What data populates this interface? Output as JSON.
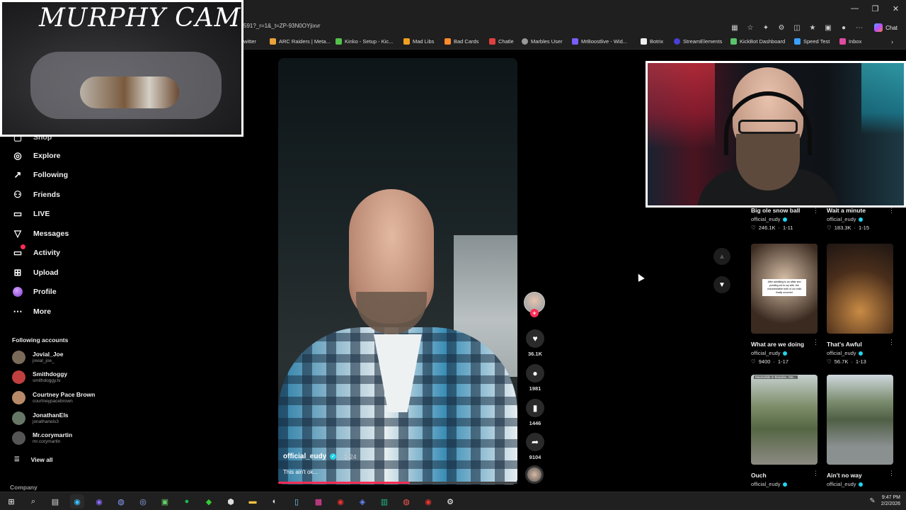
{
  "browser": {
    "url": "591?_r=1&_t=ZP-93N0OYjixvr",
    "chat_label": "Chat",
    "bookmarks": [
      "witter",
      "ARC Raiders | Meta...",
      "Kinko - Setup - Kic...",
      "Mad Libs",
      "Bad Cards",
      "Chatle",
      "Marbles User",
      "MrBoostlive - Wid...",
      "Botrix",
      "StreamElements",
      "KickBot Dashboard",
      "Speed Test",
      "Inbox"
    ]
  },
  "overlay": {
    "cam_title": "MURPHY CAM"
  },
  "sidebar": {
    "partial_item": "Shop",
    "items": [
      {
        "label": "Explore",
        "icon": "compass-icon"
      },
      {
        "label": "Following",
        "icon": "arrow-follow-icon"
      },
      {
        "label": "Friends",
        "icon": "friends-icon"
      },
      {
        "label": "LIVE",
        "icon": "live-icon"
      },
      {
        "label": "Messages",
        "icon": "paper-plane-icon"
      },
      {
        "label": "Activity",
        "icon": "activity-icon"
      },
      {
        "label": "Upload",
        "icon": "upload-icon"
      },
      {
        "label": "Profile",
        "icon": "profile-avatar-icon"
      },
      {
        "label": "More",
        "icon": "ellipsis-icon"
      }
    ],
    "following_title": "Following accounts",
    "accounts": [
      {
        "name": "Jovial_Joe",
        "handle": "jovial_joe_",
        "color": "#7a6a5a"
      },
      {
        "name": "Smithdoggy",
        "handle": "smithdoggy.tv",
        "color": "#c04040"
      },
      {
        "name": "Courtney Pace Brown",
        "handle": "courtneypacebrown",
        "color": "#b88a6a"
      },
      {
        "name": "JonathanEls",
        "handle": "jonathanels3",
        "color": "#667766"
      },
      {
        "name": "Mr.corymartin",
        "handle": "mr.corymartin",
        "color": "#555"
      }
    ],
    "view_all": "View all",
    "company": "Company"
  },
  "video": {
    "username": "official_eudy",
    "date": "· 1-24",
    "caption": "This ain't ok...",
    "progress": 0.55,
    "likes": "36.1K",
    "comments": "1981",
    "saves": "1446",
    "shares": "9104"
  },
  "grid": [
    {
      "title": "Big ole snow ball",
      "author": "official_eudy",
      "likes": "246.1K",
      "date": "1-11",
      "thumb": "none"
    },
    {
      "title": "Wait a minute",
      "author": "official_eudy",
      "likes": "183.3K",
      "date": "1-15",
      "thumb": "none"
    },
    {
      "title": "What are we doing",
      "author": "official_eudy",
      "likes": "9400",
      "date": "1-17",
      "thumb": "a",
      "caption": "After admitting to an affair and pointing out to my wife, the uncomfortable truth of our child finally occurred"
    },
    {
      "title": "That's Awful",
      "author": "official_eudy",
      "likes": "56.7K",
      "date": "1-13",
      "thumb": "b"
    },
    {
      "title": "Ouch",
      "author": "official_eudy",
      "likes": "",
      "date": "",
      "thumb": "c",
      "caption": "Meanwhile in Brandon, MS..."
    },
    {
      "title": "Ain't no way",
      "author": "official_eudy",
      "likes": "",
      "date": "",
      "thumb": "d"
    }
  ],
  "taskbar": {
    "time": "9:47 PM",
    "date": "2/2/2026"
  }
}
